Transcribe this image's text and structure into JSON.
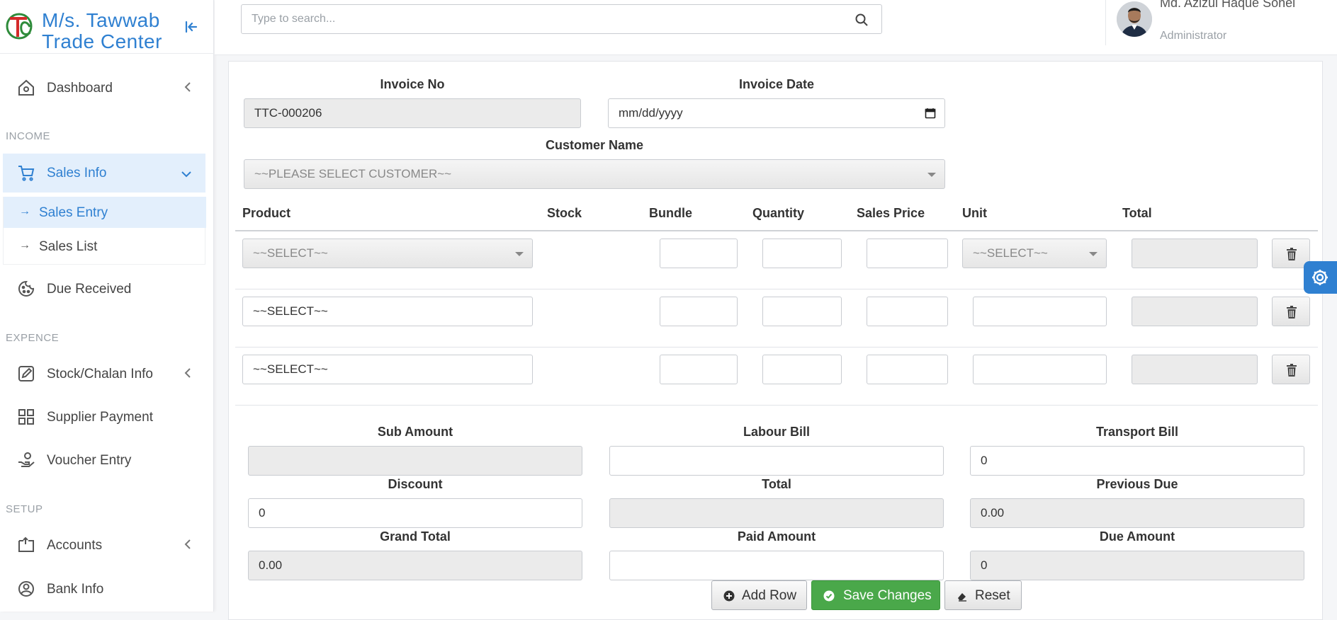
{
  "brand": {
    "name_line1": "M/s. Tawwab",
    "name_line2": "Trade Center"
  },
  "sidebar": {
    "dashboard": "Dashboard",
    "income_label": "INCOME",
    "sales_info": "Sales Info",
    "sales_entry": "Sales Entry",
    "sales_list": "Sales List",
    "due_received": "Due Received",
    "expence_label": "EXPENCE",
    "stock_chalan": "Stock/Chalan Info",
    "supplier_payment": "Supplier Payment",
    "voucher_entry": "Voucher Entry",
    "setup_label": "SETUP",
    "accounts": "Accounts",
    "bank_info": "Bank Info"
  },
  "header": {
    "search_placeholder": "Type to search...",
    "user_name": "Md. Azizul Haque Sohel",
    "user_role": "Administrator"
  },
  "form": {
    "invoice_no_label": "Invoice No",
    "invoice_no_value": "TTC-000206",
    "invoice_date_label": "Invoice Date",
    "invoice_date_placeholder": "mm/dd/yyyy",
    "customer_label": "Customer Name",
    "customer_value": "~~PLEASE SELECT CUSTOMER~~"
  },
  "table": {
    "columns": [
      "Product",
      "Stock",
      "Bundle",
      "Quantity",
      "Sales Price",
      "Unit",
      "Total"
    ],
    "rows": [
      {
        "product": "~~SELECT~~",
        "unit": "~~SELECT~~"
      },
      {
        "product": "~~SELECT~~",
        "unit": ""
      },
      {
        "product": "~~SELECT~~",
        "unit": ""
      }
    ]
  },
  "summary": {
    "sub_amount_label": "Sub Amount",
    "sub_amount_value": "",
    "labour_bill_label": "Labour Bill",
    "labour_bill_value": "",
    "transport_bill_label": "Transport Bill",
    "transport_bill_value": "0",
    "discount_label": "Discount",
    "discount_value": "0",
    "total_label": "Total",
    "total_value": "",
    "previous_due_label": "Previous Due",
    "previous_due_value": "0.00",
    "grand_total_label": "Grand Total",
    "grand_total_value": "0.00",
    "paid_amount_label": "Paid Amount",
    "paid_amount_value": "",
    "due_amount_label": "Due Amount",
    "due_amount_value": "0"
  },
  "buttons": {
    "add_row": "Add Row",
    "save_changes": "Save Changes",
    "reset": "Reset"
  },
  "colors": {
    "brand_blue": "#2f80d1",
    "active_bg": "#e3effc",
    "save_green": "#4aa84a"
  }
}
